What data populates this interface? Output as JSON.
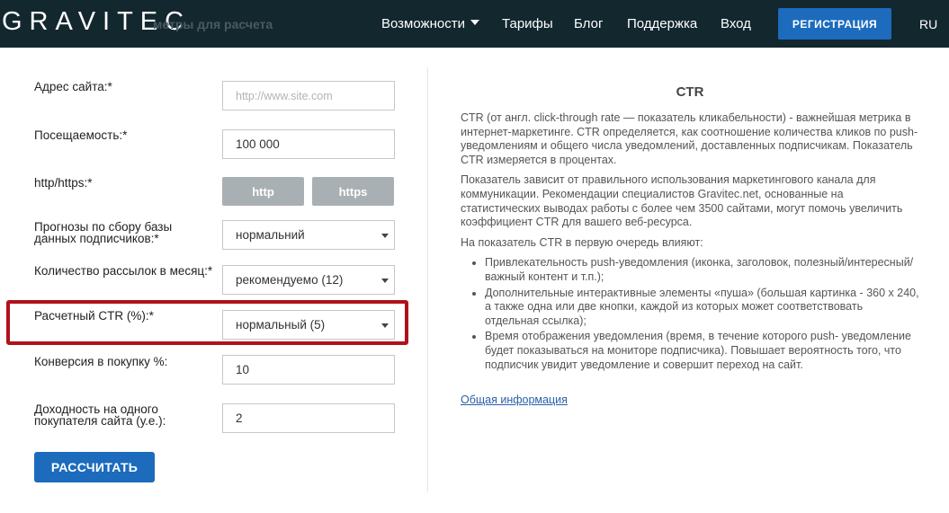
{
  "header": {
    "logo": "GRAVITEC",
    "ghost_title": "метры для расчета",
    "nav": [
      {
        "label": "Возможности",
        "has_dropdown": true
      },
      {
        "label": "Тарифы"
      },
      {
        "label": "Блог"
      },
      {
        "label": "Поддержка"
      },
      {
        "label": "Вход"
      }
    ],
    "register_label": "РЕГИСТРАЦИЯ",
    "language": "RU"
  },
  "form": {
    "site_address": {
      "label": "Адрес сайта:*",
      "placeholder": "http://www.site.com",
      "value": ""
    },
    "traffic": {
      "label": "Посещаемость:*",
      "value": "100 000"
    },
    "protocol": {
      "label": "http/https:*",
      "options": [
        "http",
        "https"
      ]
    },
    "forecast": {
      "label": "Прогнозы по сбору базы данных подписчиков:*",
      "value": "нормальний"
    },
    "mailings": {
      "label": "Количество рассылок в месяц:*",
      "value": "рекомендуемо (12)"
    },
    "ctr": {
      "label": "Расчетный CTR (%):*",
      "value": "нормальный (5)"
    },
    "conversion": {
      "label": "Конверсия в покупку %:",
      "value": "10"
    },
    "revenue": {
      "label": "Доходность на одного покупателя сайта (у.е.):",
      "value": "2"
    },
    "calculate_label": "РАССЧИТАТЬ"
  },
  "info": {
    "title": "CTR",
    "paragraphs": [
      "CTR (от англ. click-through rate — показатель кликабельности) - важнейшая метрика в интернет-маркетинге. CTR определяется, как соотношение количества кликов по push-уведомлениям и общего числа уведомлений, доставленных подписчикам. Показатель CTR измеряется в процентах.",
      "Показатель зависит от правильного использования маркетингового канала для коммуникации. Рекомендации специалистов Gravitec.net, основанные на статистических выводах работы с более чем 3500 сайтами, могут помочь увеличить коэффициент CTR для вашего веб-ресурса.",
      "На показатель CTR в первую очередь влияют:"
    ],
    "list": [
      "Привлекательность push-уведомления (иконка, заголовок, полезный/интересный/важный контент и т.п.);",
      "Дополнительные интерактивные элементы «пуша» (большая картинка - 360 x 240, а также одна или две кнопки, каждой из которых может соответствовать отдельная ссылка);",
      "Время отображения уведомления (время, в течение которого push- уведомление будет показываться на мониторе подписчика). Повышает вероятность того, что подписчик увидит уведомление и совершит переход на сайт."
    ],
    "link_label": "Общая информация"
  },
  "colors": {
    "header_bg": "#13272f",
    "accent_blue": "#1c6bbd",
    "highlight_red": "#b0121b",
    "toggle_gray": "#a9b0b3"
  }
}
